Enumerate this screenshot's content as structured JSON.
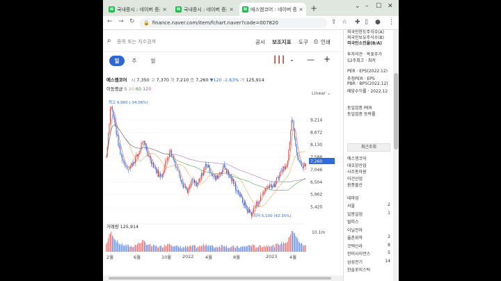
{
  "tabs": [
    {
      "label": "국내증시 : 네이버 증권"
    },
    {
      "label": "국내증시 : 네이버 증권"
    },
    {
      "label": "에스엠코어 : 네이버 증권"
    }
  ],
  "address": {
    "url": "finance.naver.com/item/fchart.naver?code=007820"
  },
  "search": {
    "placeholder": "종목 또는 지수검색"
  },
  "header_links": {
    "notice": "공시",
    "indicator": "보조지표",
    "tool": "도구",
    "print": "인쇄"
  },
  "periods": [
    "일",
    "주",
    "월"
  ],
  "stock": {
    "name": "에스엠코어",
    "open_label": "시",
    "open": "7,350",
    "high_label": "고",
    "high": "7,370",
    "low_label": "저",
    "low": "7,210",
    "close_label": "종",
    "close": "7,260",
    "change": "▼120",
    "change_pct": "-1.63%",
    "vol_label": "거",
    "volume": "125,914"
  },
  "ma": {
    "label": "이동평균",
    "m5": "5",
    "m20": "20",
    "m60": "60",
    "m120": "120"
  },
  "scale_mode": "Linear",
  "annotations": {
    "high": "최고 9,960 (-34.06%)",
    "low": "최저 5,100 (42.35%)"
  },
  "y_ticks": [
    "9,214",
    "8,672",
    "8,130",
    "7,588",
    "7,046",
    "6,504",
    "5,962",
    "5,420"
  ],
  "current_price": "7,260",
  "volume_label": "거래량 125,914",
  "volume_max": "10.1m",
  "x_ticks": [
    "2월",
    "6월",
    "10월",
    "2022",
    "4월",
    "8월",
    "2023",
    "4월"
  ],
  "colors": {
    "up": "#e8413a",
    "down": "#2f6ae0",
    "ma5": "#e8413a",
    "ma20": "#f0a030",
    "ma60": "#2ca02c",
    "ma120": "#9b59b6",
    "accent": "#2c66d9"
  },
  "chart_data": {
    "type": "candlestick",
    "ylim": [
      5100,
      9960
    ],
    "price_path": [
      7600,
      9960,
      8900,
      7800,
      7300,
      7100,
      7400,
      7700,
      8300,
      7800,
      7400,
      7000,
      6700,
      7300,
      7900,
      7400,
      6900,
      6400,
      6100,
      6600,
      6300,
      6800,
      7300,
      7000,
      6600,
      6900,
      7200,
      6800,
      6500,
      6100,
      5700,
      5300,
      5100,
      5500,
      5800,
      6200,
      6400,
      6300,
      6800,
      7100,
      7400,
      9500,
      7700,
      7200,
      7260
    ],
    "volume_path": [
      0.3,
      0.9,
      0.5,
      0.3,
      0.25,
      0.2,
      0.2,
      0.3,
      0.45,
      0.3,
      0.2,
      0.2,
      0.15,
      0.25,
      0.35,
      0.2,
      0.15,
      0.15,
      0.15,
      0.2,
      0.15,
      0.2,
      0.3,
      0.2,
      0.15,
      0.2,
      0.25,
      0.15,
      0.15,
      0.15,
      0.15,
      0.2,
      0.25,
      0.15,
      0.2,
      0.2,
      0.25,
      0.2,
      0.3,
      0.35,
      0.4,
      1.0,
      0.6,
      0.3,
      0.2
    ]
  },
  "right_panel": {
    "top_lines": [
      "외국인한도주식수(A)",
      "외국인보유주식수(B)",
      "외국인소진율(B/A)"
    ],
    "invest_lines": [
      "투자의견 · 목표주가",
      "52주최고 · 최저"
    ],
    "per_lines": [
      "PER · EPS(2022.12)",
      "추정PER · EPS",
      "PBR · BPS(2022.12)",
      "배당수익률 · 2022.12"
    ],
    "sector_lines": [
      "동일업종 PER",
      "동일업종 등락률"
    ],
    "recent_title": "최근조회",
    "recent_items": [
      "에스엠코어",
      "대호양산업",
      "사조동아원",
      "이건산업",
      "원풍물산"
    ],
    "theme_title": "테마업",
    "theme_items": [
      {
        "name": "서울",
        "count": "2"
      },
      {
        "name": "일몽실업",
        "count": "1"
      },
      {
        "name": "릴피스",
        "count": ""
      },
      {
        "name": "이닐전자",
        "count": ""
      },
      {
        "name": "율촌화학",
        "count": "2"
      },
      {
        "name": "코텍신라",
        "count": "8"
      },
      {
        "name": "한미사이언스",
        "count": "5"
      },
      {
        "name": "삼성전기",
        "count": "14"
      },
      {
        "name": "한솔로지스틱",
        "count": ""
      }
    ]
  }
}
